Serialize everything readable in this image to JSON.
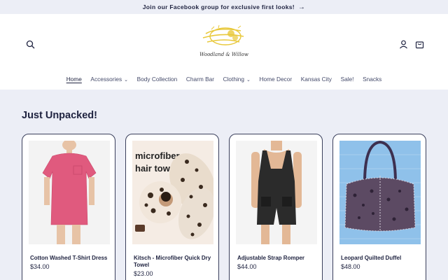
{
  "announcement": {
    "text": "Join our Facebook group for exclusive first looks!",
    "arrow": "→"
  },
  "header": {
    "logo_text": "Woodland & Willow",
    "icons": {
      "search": "search-icon",
      "account": "account-icon",
      "cart": "cart-icon"
    }
  },
  "nav": {
    "items": [
      {
        "label": "Home",
        "active": true,
        "dropdown": false
      },
      {
        "label": "Accessories",
        "active": false,
        "dropdown": true
      },
      {
        "label": "Body Collection",
        "active": false,
        "dropdown": false
      },
      {
        "label": "Charm Bar",
        "active": false,
        "dropdown": false
      },
      {
        "label": "Clothing",
        "active": false,
        "dropdown": true
      },
      {
        "label": "Home Decor",
        "active": false,
        "dropdown": false
      },
      {
        "label": "Kansas City",
        "active": false,
        "dropdown": false
      },
      {
        "label": "Sale!",
        "active": false,
        "dropdown": false
      },
      {
        "label": "Snacks",
        "active": false,
        "dropdown": false
      }
    ],
    "chevron": "⌄"
  },
  "section": {
    "title": "Just Unpacked!"
  },
  "products": [
    {
      "title": "Cotton Washed T-Shirt Dress",
      "price": "$34.00"
    },
    {
      "title": "Kitsch - Microfiber Quick Dry Towel",
      "price": "$23.00",
      "image_text_1": "microfiber",
      "image_text_2": "hair towel."
    },
    {
      "title": "Adjustable Strap Romper",
      "price": "$44.00"
    },
    {
      "title": "Leopard Quilted Duffel",
      "price": "$48.00"
    }
  ],
  "colors": {
    "text": "#1f2340",
    "background": "#eceef6",
    "header_bg": "#ffffff",
    "card_border": "#3a3f5c",
    "logo_gold": "#e8c83a"
  }
}
